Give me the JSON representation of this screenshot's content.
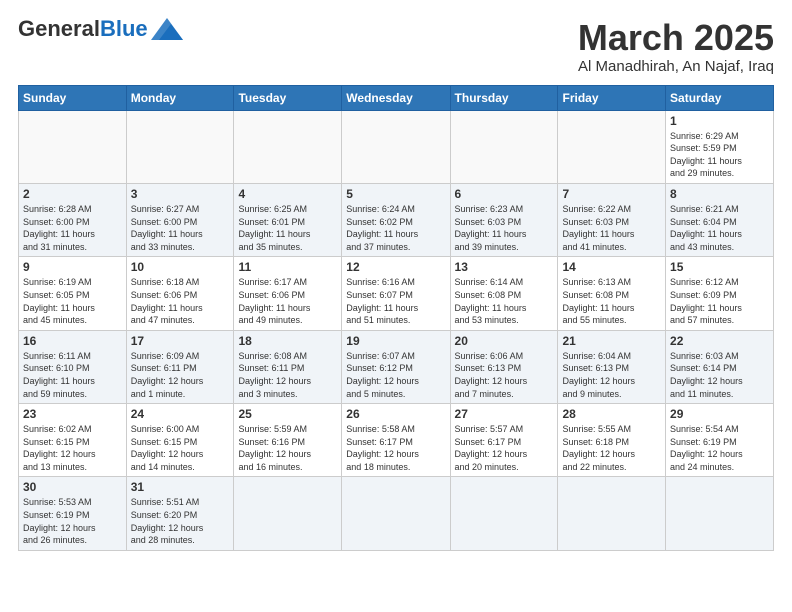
{
  "header": {
    "logo_general": "General",
    "logo_blue": "Blue",
    "month": "March 2025",
    "location": "Al Manadhirah, An Najaf, Iraq"
  },
  "weekdays": [
    "Sunday",
    "Monday",
    "Tuesday",
    "Wednesday",
    "Thursday",
    "Friday",
    "Saturday"
  ],
  "weeks": [
    [
      {
        "day": "",
        "info": ""
      },
      {
        "day": "",
        "info": ""
      },
      {
        "day": "",
        "info": ""
      },
      {
        "day": "",
        "info": ""
      },
      {
        "day": "",
        "info": ""
      },
      {
        "day": "",
        "info": ""
      },
      {
        "day": "1",
        "info": "Sunrise: 6:29 AM\nSunset: 5:59 PM\nDaylight: 11 hours\nand 29 minutes."
      }
    ],
    [
      {
        "day": "2",
        "info": "Sunrise: 6:28 AM\nSunset: 6:00 PM\nDaylight: 11 hours\nand 31 minutes."
      },
      {
        "day": "3",
        "info": "Sunrise: 6:27 AM\nSunset: 6:00 PM\nDaylight: 11 hours\nand 33 minutes."
      },
      {
        "day": "4",
        "info": "Sunrise: 6:25 AM\nSunset: 6:01 PM\nDaylight: 11 hours\nand 35 minutes."
      },
      {
        "day": "5",
        "info": "Sunrise: 6:24 AM\nSunset: 6:02 PM\nDaylight: 11 hours\nand 37 minutes."
      },
      {
        "day": "6",
        "info": "Sunrise: 6:23 AM\nSunset: 6:03 PM\nDaylight: 11 hours\nand 39 minutes."
      },
      {
        "day": "7",
        "info": "Sunrise: 6:22 AM\nSunset: 6:03 PM\nDaylight: 11 hours\nand 41 minutes."
      },
      {
        "day": "8",
        "info": "Sunrise: 6:21 AM\nSunset: 6:04 PM\nDaylight: 11 hours\nand 43 minutes."
      }
    ],
    [
      {
        "day": "9",
        "info": "Sunrise: 6:19 AM\nSunset: 6:05 PM\nDaylight: 11 hours\nand 45 minutes."
      },
      {
        "day": "10",
        "info": "Sunrise: 6:18 AM\nSunset: 6:06 PM\nDaylight: 11 hours\nand 47 minutes."
      },
      {
        "day": "11",
        "info": "Sunrise: 6:17 AM\nSunset: 6:06 PM\nDaylight: 11 hours\nand 49 minutes."
      },
      {
        "day": "12",
        "info": "Sunrise: 6:16 AM\nSunset: 6:07 PM\nDaylight: 11 hours\nand 51 minutes."
      },
      {
        "day": "13",
        "info": "Sunrise: 6:14 AM\nSunset: 6:08 PM\nDaylight: 11 hours\nand 53 minutes."
      },
      {
        "day": "14",
        "info": "Sunrise: 6:13 AM\nSunset: 6:08 PM\nDaylight: 11 hours\nand 55 minutes."
      },
      {
        "day": "15",
        "info": "Sunrise: 6:12 AM\nSunset: 6:09 PM\nDaylight: 11 hours\nand 57 minutes."
      }
    ],
    [
      {
        "day": "16",
        "info": "Sunrise: 6:11 AM\nSunset: 6:10 PM\nDaylight: 11 hours\nand 59 minutes."
      },
      {
        "day": "17",
        "info": "Sunrise: 6:09 AM\nSunset: 6:11 PM\nDaylight: 12 hours\nand 1 minute."
      },
      {
        "day": "18",
        "info": "Sunrise: 6:08 AM\nSunset: 6:11 PM\nDaylight: 12 hours\nand 3 minutes."
      },
      {
        "day": "19",
        "info": "Sunrise: 6:07 AM\nSunset: 6:12 PM\nDaylight: 12 hours\nand 5 minutes."
      },
      {
        "day": "20",
        "info": "Sunrise: 6:06 AM\nSunset: 6:13 PM\nDaylight: 12 hours\nand 7 minutes."
      },
      {
        "day": "21",
        "info": "Sunrise: 6:04 AM\nSunset: 6:13 PM\nDaylight: 12 hours\nand 9 minutes."
      },
      {
        "day": "22",
        "info": "Sunrise: 6:03 AM\nSunset: 6:14 PM\nDaylight: 12 hours\nand 11 minutes."
      }
    ],
    [
      {
        "day": "23",
        "info": "Sunrise: 6:02 AM\nSunset: 6:15 PM\nDaylight: 12 hours\nand 13 minutes."
      },
      {
        "day": "24",
        "info": "Sunrise: 6:00 AM\nSunset: 6:15 PM\nDaylight: 12 hours\nand 14 minutes."
      },
      {
        "day": "25",
        "info": "Sunrise: 5:59 AM\nSunset: 6:16 PM\nDaylight: 12 hours\nand 16 minutes."
      },
      {
        "day": "26",
        "info": "Sunrise: 5:58 AM\nSunset: 6:17 PM\nDaylight: 12 hours\nand 18 minutes."
      },
      {
        "day": "27",
        "info": "Sunrise: 5:57 AM\nSunset: 6:17 PM\nDaylight: 12 hours\nand 20 minutes."
      },
      {
        "day": "28",
        "info": "Sunrise: 5:55 AM\nSunset: 6:18 PM\nDaylight: 12 hours\nand 22 minutes."
      },
      {
        "day": "29",
        "info": "Sunrise: 5:54 AM\nSunset: 6:19 PM\nDaylight: 12 hours\nand 24 minutes."
      }
    ],
    [
      {
        "day": "30",
        "info": "Sunrise: 5:53 AM\nSunset: 6:19 PM\nDaylight: 12 hours\nand 26 minutes."
      },
      {
        "day": "31",
        "info": "Sunrise: 5:51 AM\nSunset: 6:20 PM\nDaylight: 12 hours\nand 28 minutes."
      },
      {
        "day": "",
        "info": ""
      },
      {
        "day": "",
        "info": ""
      },
      {
        "day": "",
        "info": ""
      },
      {
        "day": "",
        "info": ""
      },
      {
        "day": "",
        "info": ""
      }
    ]
  ]
}
